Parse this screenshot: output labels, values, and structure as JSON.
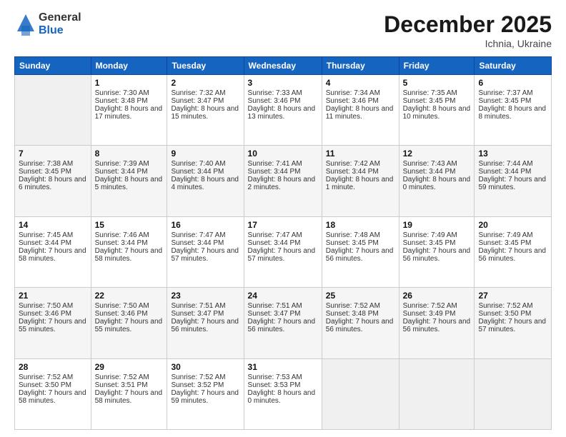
{
  "header": {
    "logo_line1": "General",
    "logo_line2": "Blue",
    "month_year": "December 2025",
    "location": "Ichnia, Ukraine"
  },
  "weekdays": [
    "Sunday",
    "Monday",
    "Tuesday",
    "Wednesday",
    "Thursday",
    "Friday",
    "Saturday"
  ],
  "weeks": [
    [
      {
        "day": "",
        "sunrise": "",
        "sunset": "",
        "daylight": ""
      },
      {
        "day": "1",
        "sunrise": "Sunrise: 7:30 AM",
        "sunset": "Sunset: 3:48 PM",
        "daylight": "Daylight: 8 hours and 17 minutes."
      },
      {
        "day": "2",
        "sunrise": "Sunrise: 7:32 AM",
        "sunset": "Sunset: 3:47 PM",
        "daylight": "Daylight: 8 hours and 15 minutes."
      },
      {
        "day": "3",
        "sunrise": "Sunrise: 7:33 AM",
        "sunset": "Sunset: 3:46 PM",
        "daylight": "Daylight: 8 hours and 13 minutes."
      },
      {
        "day": "4",
        "sunrise": "Sunrise: 7:34 AM",
        "sunset": "Sunset: 3:46 PM",
        "daylight": "Daylight: 8 hours and 11 minutes."
      },
      {
        "day": "5",
        "sunrise": "Sunrise: 7:35 AM",
        "sunset": "Sunset: 3:45 PM",
        "daylight": "Daylight: 8 hours and 10 minutes."
      },
      {
        "day": "6",
        "sunrise": "Sunrise: 7:37 AM",
        "sunset": "Sunset: 3:45 PM",
        "daylight": "Daylight: 8 hours and 8 minutes."
      }
    ],
    [
      {
        "day": "7",
        "sunrise": "Sunrise: 7:38 AM",
        "sunset": "Sunset: 3:45 PM",
        "daylight": "Daylight: 8 hours and 6 minutes."
      },
      {
        "day": "8",
        "sunrise": "Sunrise: 7:39 AM",
        "sunset": "Sunset: 3:44 PM",
        "daylight": "Daylight: 8 hours and 5 minutes."
      },
      {
        "day": "9",
        "sunrise": "Sunrise: 7:40 AM",
        "sunset": "Sunset: 3:44 PM",
        "daylight": "Daylight: 8 hours and 4 minutes."
      },
      {
        "day": "10",
        "sunrise": "Sunrise: 7:41 AM",
        "sunset": "Sunset: 3:44 PM",
        "daylight": "Daylight: 8 hours and 2 minutes."
      },
      {
        "day": "11",
        "sunrise": "Sunrise: 7:42 AM",
        "sunset": "Sunset: 3:44 PM",
        "daylight": "Daylight: 8 hours and 1 minute."
      },
      {
        "day": "12",
        "sunrise": "Sunrise: 7:43 AM",
        "sunset": "Sunset: 3:44 PM",
        "daylight": "Daylight: 8 hours and 0 minutes."
      },
      {
        "day": "13",
        "sunrise": "Sunrise: 7:44 AM",
        "sunset": "Sunset: 3:44 PM",
        "daylight": "Daylight: 7 hours and 59 minutes."
      }
    ],
    [
      {
        "day": "14",
        "sunrise": "Sunrise: 7:45 AM",
        "sunset": "Sunset: 3:44 PM",
        "daylight": "Daylight: 7 hours and 58 minutes."
      },
      {
        "day": "15",
        "sunrise": "Sunrise: 7:46 AM",
        "sunset": "Sunset: 3:44 PM",
        "daylight": "Daylight: 7 hours and 58 minutes."
      },
      {
        "day": "16",
        "sunrise": "Sunrise: 7:47 AM",
        "sunset": "Sunset: 3:44 PM",
        "daylight": "Daylight: 7 hours and 57 minutes."
      },
      {
        "day": "17",
        "sunrise": "Sunrise: 7:47 AM",
        "sunset": "Sunset: 3:44 PM",
        "daylight": "Daylight: 7 hours and 57 minutes."
      },
      {
        "day": "18",
        "sunrise": "Sunrise: 7:48 AM",
        "sunset": "Sunset: 3:45 PM",
        "daylight": "Daylight: 7 hours and 56 minutes."
      },
      {
        "day": "19",
        "sunrise": "Sunrise: 7:49 AM",
        "sunset": "Sunset: 3:45 PM",
        "daylight": "Daylight: 7 hours and 56 minutes."
      },
      {
        "day": "20",
        "sunrise": "Sunrise: 7:49 AM",
        "sunset": "Sunset: 3:45 PM",
        "daylight": "Daylight: 7 hours and 56 minutes."
      }
    ],
    [
      {
        "day": "21",
        "sunrise": "Sunrise: 7:50 AM",
        "sunset": "Sunset: 3:46 PM",
        "daylight": "Daylight: 7 hours and 55 minutes."
      },
      {
        "day": "22",
        "sunrise": "Sunrise: 7:50 AM",
        "sunset": "Sunset: 3:46 PM",
        "daylight": "Daylight: 7 hours and 55 minutes."
      },
      {
        "day": "23",
        "sunrise": "Sunrise: 7:51 AM",
        "sunset": "Sunset: 3:47 PM",
        "daylight": "Daylight: 7 hours and 56 minutes."
      },
      {
        "day": "24",
        "sunrise": "Sunrise: 7:51 AM",
        "sunset": "Sunset: 3:47 PM",
        "daylight": "Daylight: 7 hours and 56 minutes."
      },
      {
        "day": "25",
        "sunrise": "Sunrise: 7:52 AM",
        "sunset": "Sunset: 3:48 PM",
        "daylight": "Daylight: 7 hours and 56 minutes."
      },
      {
        "day": "26",
        "sunrise": "Sunrise: 7:52 AM",
        "sunset": "Sunset: 3:49 PM",
        "daylight": "Daylight: 7 hours and 56 minutes."
      },
      {
        "day": "27",
        "sunrise": "Sunrise: 7:52 AM",
        "sunset": "Sunset: 3:50 PM",
        "daylight": "Daylight: 7 hours and 57 minutes."
      }
    ],
    [
      {
        "day": "28",
        "sunrise": "Sunrise: 7:52 AM",
        "sunset": "Sunset: 3:50 PM",
        "daylight": "Daylight: 7 hours and 58 minutes."
      },
      {
        "day": "29",
        "sunrise": "Sunrise: 7:52 AM",
        "sunset": "Sunset: 3:51 PM",
        "daylight": "Daylight: 7 hours and 58 minutes."
      },
      {
        "day": "30",
        "sunrise": "Sunrise: 7:52 AM",
        "sunset": "Sunset: 3:52 PM",
        "daylight": "Daylight: 7 hours and 59 minutes."
      },
      {
        "day": "31",
        "sunrise": "Sunrise: 7:53 AM",
        "sunset": "Sunset: 3:53 PM",
        "daylight": "Daylight: 8 hours and 0 minutes."
      },
      {
        "day": "",
        "sunrise": "",
        "sunset": "",
        "daylight": ""
      },
      {
        "day": "",
        "sunrise": "",
        "sunset": "",
        "daylight": ""
      },
      {
        "day": "",
        "sunrise": "",
        "sunset": "",
        "daylight": ""
      }
    ]
  ]
}
